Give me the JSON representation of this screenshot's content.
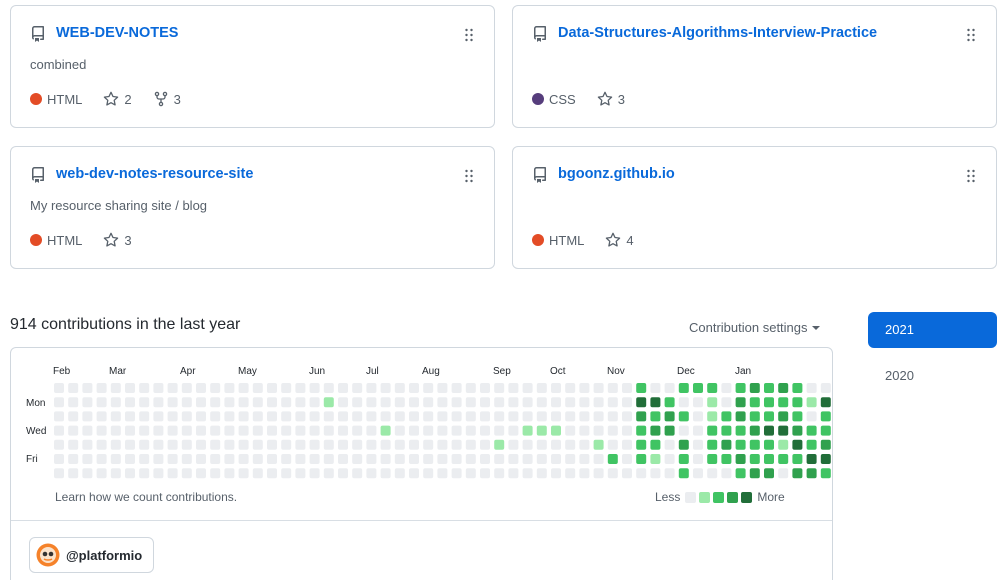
{
  "pinned": [
    {
      "name": "WEB-DEV-NOTES",
      "description": "combined",
      "language": "HTML",
      "language_color": "#e34c26",
      "stars": "2",
      "forks": "3"
    },
    {
      "name": "Data-Structures-Algorithms-Interview-Practice",
      "description": "",
      "language": "CSS",
      "language_color": "#563d7c",
      "stars": "3",
      "forks": ""
    },
    {
      "name": "web-dev-notes-resource-site",
      "description": "My resource sharing site / blog",
      "language": "HTML",
      "language_color": "#e34c26",
      "stars": "3",
      "forks": ""
    },
    {
      "name": "bgoonz.github.io",
      "description": "",
      "language": "HTML",
      "language_color": "#e34c26",
      "stars": "4",
      "forks": ""
    }
  ],
  "contributions": {
    "title": "914 contributions in the last year",
    "settings_label": "Contribution settings",
    "learn_link": "Learn how we count contributions.",
    "legend_less": "Less",
    "legend_more": "More",
    "level_colors": [
      "#ebedf0",
      "#9be9a8",
      "#40c463",
      "#30a14e",
      "#216e39"
    ],
    "months": [
      "Feb",
      "Mar",
      "Apr",
      "May",
      "Jun",
      "Jul",
      "Aug",
      "Sep",
      "Oct",
      "Nov",
      "Dec",
      "Jan"
    ],
    "days": [
      "Mon",
      "Wed",
      "Fri"
    ],
    "weeks": [
      [
        0,
        0,
        0,
        0,
        0,
        0,
        0
      ],
      [
        0,
        0,
        0,
        0,
        0,
        0,
        0
      ],
      [
        0,
        0,
        0,
        0,
        0,
        0,
        0
      ],
      [
        0,
        0,
        0,
        0,
        0,
        0,
        0
      ],
      [
        0,
        0,
        0,
        0,
        0,
        0,
        0
      ],
      [
        0,
        0,
        0,
        0,
        0,
        0,
        0
      ],
      [
        0,
        0,
        0,
        0,
        0,
        0,
        0
      ],
      [
        0,
        0,
        0,
        0,
        0,
        0,
        0
      ],
      [
        0,
        0,
        0,
        0,
        0,
        0,
        0
      ],
      [
        0,
        0,
        0,
        0,
        0,
        0,
        0
      ],
      [
        0,
        0,
        0,
        0,
        0,
        0,
        0
      ],
      [
        0,
        0,
        0,
        0,
        0,
        0,
        0
      ],
      [
        0,
        0,
        0,
        0,
        0,
        0,
        0
      ],
      [
        0,
        0,
        0,
        0,
        0,
        0,
        0
      ],
      [
        0,
        0,
        0,
        0,
        0,
        0,
        0
      ],
      [
        0,
        0,
        0,
        0,
        0,
        0,
        0
      ],
      [
        0,
        0,
        0,
        0,
        0,
        0,
        0
      ],
      [
        0,
        0,
        0,
        0,
        0,
        0,
        0
      ],
      [
        0,
        0,
        0,
        0,
        0,
        0,
        0
      ],
      [
        0,
        1,
        0,
        0,
        0,
        0,
        0
      ],
      [
        0,
        0,
        0,
        0,
        0,
        0,
        0
      ],
      [
        0,
        0,
        0,
        0,
        0,
        0,
        0
      ],
      [
        0,
        0,
        0,
        0,
        0,
        0,
        0
      ],
      [
        0,
        0,
        0,
        1,
        0,
        0,
        0
      ],
      [
        0,
        0,
        0,
        0,
        0,
        0,
        0
      ],
      [
        0,
        0,
        0,
        0,
        0,
        0,
        0
      ],
      [
        0,
        0,
        0,
        0,
        0,
        0,
        0
      ],
      [
        0,
        0,
        0,
        0,
        0,
        0,
        0
      ],
      [
        0,
        0,
        0,
        0,
        0,
        0,
        0
      ],
      [
        0,
        0,
        0,
        0,
        0,
        0,
        0
      ],
      [
        0,
        0,
        0,
        0,
        0,
        0,
        0
      ],
      [
        0,
        0,
        0,
        0,
        1,
        0,
        0
      ],
      [
        0,
        0,
        0,
        0,
        0,
        0,
        0
      ],
      [
        0,
        0,
        0,
        1,
        0,
        0,
        0
      ],
      [
        0,
        0,
        0,
        1,
        0,
        0,
        0
      ],
      [
        0,
        0,
        0,
        1,
        0,
        0,
        0
      ],
      [
        0,
        0,
        0,
        0,
        0,
        0,
        0
      ],
      [
        0,
        0,
        0,
        0,
        0,
        0,
        0
      ],
      [
        0,
        0,
        0,
        0,
        1,
        0,
        0
      ],
      [
        0,
        0,
        0,
        0,
        0,
        2,
        0
      ],
      [
        0,
        0,
        0,
        0,
        0,
        0,
        0
      ],
      [
        2,
        4,
        3,
        2,
        2,
        2,
        0
      ],
      [
        0,
        4,
        2,
        3,
        2,
        1,
        0
      ],
      [
        0,
        2,
        3,
        3,
        0,
        0,
        0
      ],
      [
        2,
        0,
        2,
        0,
        3,
        2,
        2
      ],
      [
        2,
        0,
        0,
        0,
        0,
        0,
        0
      ],
      [
        2,
        1,
        1,
        2,
        2,
        2,
        0
      ],
      [
        0,
        0,
        2,
        2,
        3,
        2,
        0
      ],
      [
        2,
        3,
        3,
        2,
        2,
        3,
        2
      ],
      [
        3,
        2,
        2,
        3,
        2,
        2,
        3
      ],
      [
        2,
        2,
        2,
        4,
        2,
        2,
        3
      ],
      [
        3,
        2,
        3,
        4,
        1,
        2,
        0
      ],
      [
        2,
        2,
        2,
        3,
        4,
        2,
        3
      ],
      [
        0,
        1,
        0,
        2,
        2,
        4,
        3
      ],
      [
        0,
        4,
        2,
        2,
        3,
        4,
        2
      ],
      [
        2,
        2,
        2,
        3,
        2,
        4,
        3
      ],
      [
        0,
        4,
        1,
        4,
        4,
        3,
        3
      ],
      [
        0,
        2,
        2,
        3,
        4,
        3,
        0
      ]
    ]
  },
  "years": [
    "2021",
    "2020"
  ],
  "activity_org": "@platformio"
}
